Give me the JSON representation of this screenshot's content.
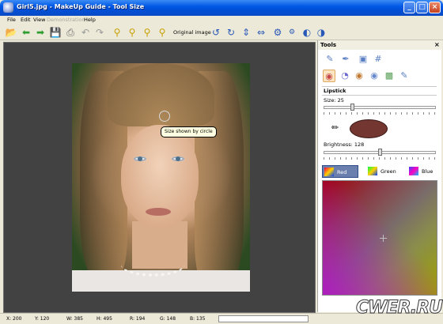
{
  "window": {
    "title": "Girl5.jpg - MakeUp Guide - Tool Size",
    "min": "_",
    "max": "□",
    "close": "×"
  },
  "menu": {
    "file": "File",
    "edit": "Edit",
    "view": "View",
    "demonstration": "Demonstration",
    "help": "Help"
  },
  "toolbar": {
    "original_image": "Original image",
    "icons": [
      "open-folder-icon",
      "back-arrow-icon",
      "forward-arrow-icon",
      "save-icon",
      "print-icon",
      "undo-icon",
      "redo-icon",
      "zoom-in-icon",
      "zoom-out-icon",
      "zoom-fit-icon",
      "zoom-actual-icon",
      "rotate-left-icon",
      "rotate-right-icon",
      "flip-vertical-icon",
      "flip-horizontal-icon",
      "settings-gear-icon",
      "small-gear-icon",
      "contrast-icon",
      "brightness-icon"
    ]
  },
  "canvas": {
    "tooltip": "Size shown by circle"
  },
  "tools_panel": {
    "title": "Tools",
    "close": "×",
    "section": "Lipstick",
    "size_label": "Size: 25",
    "size_value": 25,
    "brightness_label": "Brightness: 128",
    "brightness_value": 128,
    "swatch_color": "#733631",
    "tabs": [
      {
        "label": "Red",
        "active": true
      },
      {
        "label": "Green",
        "active": false
      },
      {
        "label": "Blue",
        "active": false
      }
    ]
  },
  "status": {
    "x": "X: 200",
    "y": "Y: 120",
    "w": "W: 385",
    "h": "H: 495",
    "r": "R: 194",
    "g": "G: 148",
    "b": "B: 135"
  },
  "watermark": "CWER.RU"
}
